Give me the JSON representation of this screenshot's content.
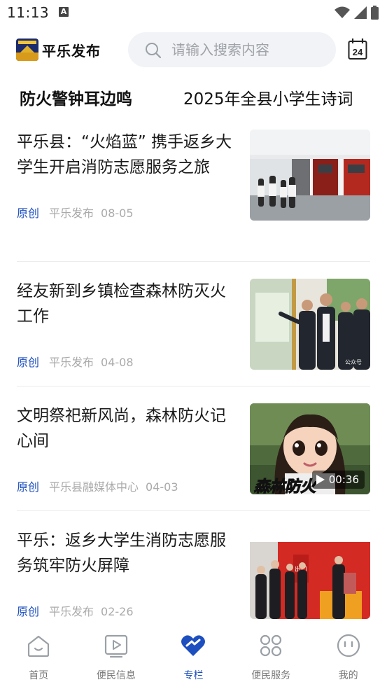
{
  "status": {
    "time": "11:13",
    "notif_badge": "A"
  },
  "header": {
    "brand": "平乐发布",
    "search_placeholder": "请输入搜索内容",
    "calendar_day": "24",
    "accent": "#1d4fbf"
  },
  "ticker": [
    "防火警钟耳边鸣",
    "2025年全县小学生诗词"
  ],
  "articles": [
    {
      "title": "平乐县：“火焰蓝” 携手返乡大学生开启消防志愿服务之旅",
      "tag": "原创",
      "source": "平乐发布",
      "date": "08-05",
      "thumb": "fire-station-photo"
    },
    {
      "title": "经友新到乡镇检查森林防灭火工作",
      "tag": "原创",
      "source": "平乐发布",
      "date": "04-08",
      "thumb": "inspection-photo",
      "watermark": "公众号"
    },
    {
      "title": "文明祭祀新风尚，森林防火记心间",
      "tag": "原创",
      "source": "平乐县融媒体中心",
      "date": "04-03",
      "thumb": "video-thumbnail",
      "duration": "00:36",
      "overlay_text": "森林防火"
    },
    {
      "title": "平乐：返乡大学生消防志愿服务筑牢防火屏障",
      "tag": "原创",
      "source": "平乐发布",
      "date": "02-26",
      "thumb": "exhibition-photo",
      "sign_text": "出口"
    }
  ],
  "nav": [
    {
      "label": "首页",
      "icon": "home-icon"
    },
    {
      "label": "便民信息",
      "icon": "play-icon"
    },
    {
      "label": "专栏",
      "icon": "heart-icon",
      "active": true
    },
    {
      "label": "便民服务",
      "icon": "grid-icon"
    },
    {
      "label": "我的",
      "icon": "smiley-icon"
    }
  ]
}
